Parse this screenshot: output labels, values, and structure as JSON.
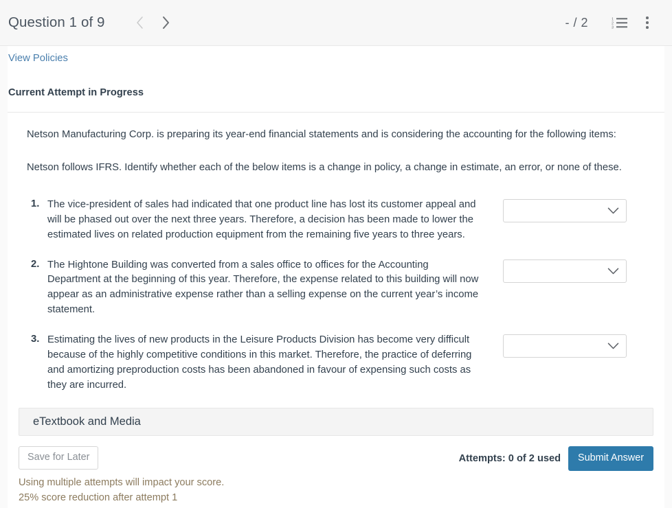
{
  "header": {
    "question_title": "Question 1 of 9",
    "prev_icon": "chevron-left-icon",
    "next_icon": "chevron-right-icon",
    "score": "- / 2",
    "list_icon": "numbered-list-icon",
    "menu_icon": "kebab-menu-icon",
    "list_icon_digits": [
      "1",
      "2",
      "3"
    ]
  },
  "content": {
    "view_policies": "View Policies",
    "attempt_heading": "Current Attempt in Progress",
    "intro_1": "Netson Manufacturing Corp. is preparing its year-end financial statements and is considering the accounting for the following items:",
    "intro_2": "Netson follows IFRS. Identify whether each of the below items is a change in policy, a change in estimate, an error, or none of these."
  },
  "items": [
    {
      "number": "1.",
      "text": "The vice-president of sales had indicated that one product line has lost its customer appeal and will be phased out over the next three years. Therefore, a decision has been made to lower the estimated lives on related production equipment from the remaining five years to three years.",
      "selected": ""
    },
    {
      "number": "2.",
      "text": "The Hightone Building was converted from a sales office to offices for the Accounting Department at the beginning of this year. Therefore, the expense related to this building will now appear as an administrative expense rather than a selling expense on the current year’s income statement.",
      "selected": ""
    },
    {
      "number": "3.",
      "text": "Estimating the lives of new products in the Leisure Products Division has become very difficult because of the highly competitive conditions in this market. Therefore, the practice of deferring and amortizing preproduction costs has been abandoned in favour of expensing such costs as they are incurred.",
      "selected": ""
    }
  ],
  "etextbook": {
    "label": "eTextbook and Media"
  },
  "footer": {
    "save_label": "Save for Later",
    "attempts_label": "Attempts: 0 of 2 used",
    "submit_label": "Submit Answer",
    "warning_line_1": "Using multiple attempts will impact your score.",
    "warning_line_2": "25% score reduction after attempt 1"
  },
  "colors": {
    "submit_blue": "#2e7bab",
    "link_blue": "#4a7fad",
    "warning_tan": "#8c7b5e",
    "text_dark": "#33414e",
    "header_bg": "#f7f7f7"
  }
}
